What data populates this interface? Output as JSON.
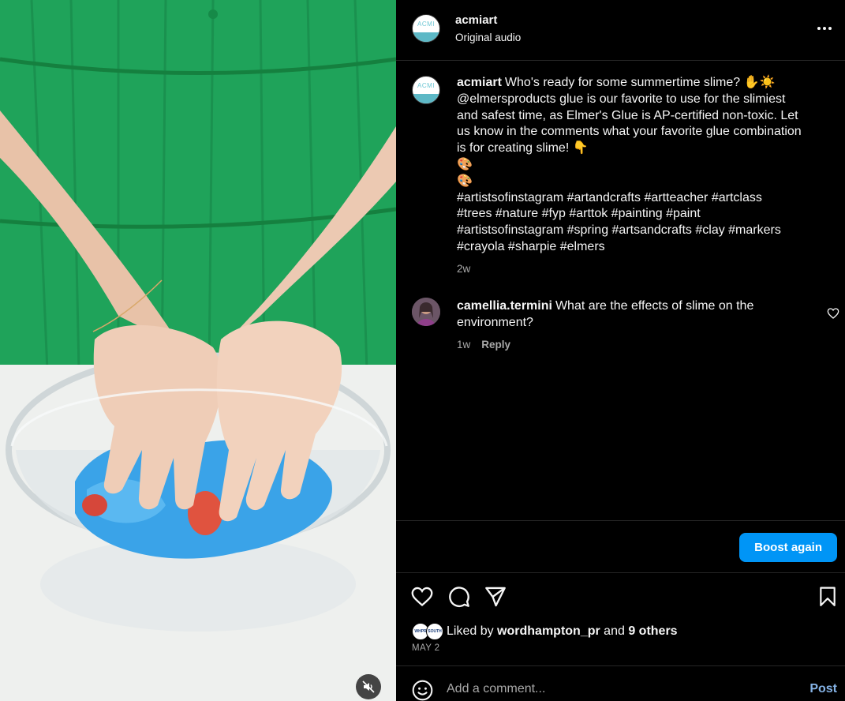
{
  "header": {
    "username": "acmiart",
    "audio": "Original audio",
    "avatar_text": "ACMI"
  },
  "caption": {
    "username": "acmiart",
    "lines": [
      "Who's ready for some summertime slime? ✋☀️",
      "@elmersproducts glue is our favorite to use for the slimiest",
      "and safest time, as Elmer's Glue is AP-certified non-toxic. Let",
      "us know in the comments what your favorite glue combination",
      "is for creating slime! 👇",
      "🎨",
      "🎨",
      "#artistsofinstagram #artandcrafts #artteacher #artclass",
      "#trees #nature #fyp #arttok #painting #paint",
      "#artistsofinstagram #spring #artsandcrafts #clay #markers",
      "#crayola #sharpie #elmers"
    ],
    "time": "2w"
  },
  "comment": {
    "username": "camellia.termini",
    "lines": [
      "What are the effects of slime on the",
      "environment?"
    ],
    "time": "1w",
    "reply_label": "Reply"
  },
  "boost": {
    "label": "Boost again"
  },
  "likes": {
    "prefix": "Liked by",
    "user": "wordhampton_pr",
    "middle": "and",
    "others": "9 others",
    "avatar_texts": [
      "WHPR",
      "SOUTH"
    ]
  },
  "date": "MAY 2",
  "comment_box": {
    "placeholder": "Add a comment...",
    "post_label": "Post"
  },
  "colors": {
    "accent": "#0095f6",
    "post_link": "#85b3e6",
    "background": "#000000",
    "secondary_text": "#a8a8a8",
    "divider": "#262626"
  },
  "icons": {
    "more": "more-horizontal-icon",
    "mute": "muted-speaker-icon",
    "like": "heart-icon",
    "comment": "speech-bubble-icon",
    "share": "paper-plane-icon",
    "save": "bookmark-icon",
    "emoji": "smiley-icon"
  }
}
